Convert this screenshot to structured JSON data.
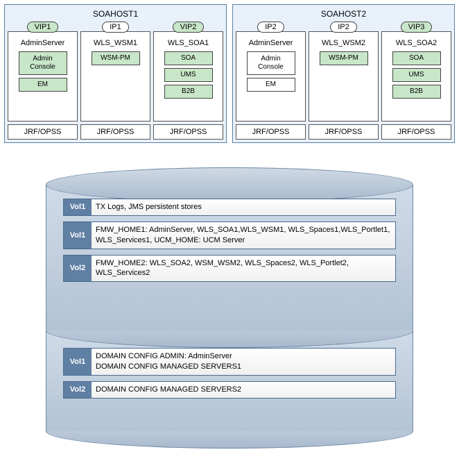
{
  "hosts": [
    {
      "title": "SOAHOST1",
      "servers": [
        {
          "pill": "VIP1",
          "pill_green": true,
          "name": "AdminServer",
          "modules": [
            {
              "text": "Admin Console",
              "green": true
            },
            {
              "text": "EM",
              "green": true
            }
          ]
        },
        {
          "pill": "IP1",
          "pill_green": false,
          "name": "WLS_WSM1",
          "modules": [
            {
              "text": "WSM-PM",
              "green": true
            }
          ]
        },
        {
          "pill": "VIP2",
          "pill_green": true,
          "name": "WLS_SOA1",
          "modules": [
            {
              "text": "SOA",
              "green": true
            },
            {
              "text": "UMS",
              "green": true
            },
            {
              "text": "B2B",
              "green": true
            }
          ]
        }
      ],
      "footers": [
        "JRF/OPSS",
        "JRF/OPSS",
        "JRF/OPSS"
      ]
    },
    {
      "title": "SOAHOST2",
      "servers": [
        {
          "pill": "IP2",
          "pill_green": false,
          "name": "AdminServer",
          "modules": [
            {
              "text": "Admin Console",
              "green": false
            },
            {
              "text": "EM",
              "green": false
            }
          ]
        },
        {
          "pill": "IP2",
          "pill_green": false,
          "name": "WLS_WSM2",
          "modules": [
            {
              "text": "WSM-PM",
              "green": true
            }
          ]
        },
        {
          "pill": "VIP3",
          "pill_green": true,
          "name": "WLS_SOA2",
          "modules": [
            {
              "text": "SOA",
              "green": true
            },
            {
              "text": "UMS",
              "green": true
            },
            {
              "text": "B2B",
              "green": true
            }
          ]
        }
      ],
      "footers": [
        "JRF/OPSS",
        "JRF/OPSS",
        "JRF/OPSS"
      ]
    }
  ],
  "disk1": {
    "volumes": [
      {
        "tag": "Vol1",
        "text": "TX Logs, JMS persistent stores"
      },
      {
        "tag": "Vol1",
        "text": "FMW_HOME1: AdminServer, WLS_SOA1,WLS_WSM1, WLS_Spaces1,WLS_Portlet1, WLS_Services1, UCM_HOME: UCM Server"
      },
      {
        "tag": "Vol2",
        "text": "FMW_HOME2: WLS_SOA2, WSM_WSM2, WLS_Spaces2, WLS_Portlet2, WLS_Services2"
      }
    ]
  },
  "disk2": {
    "volumes": [
      {
        "tag": "Vol1",
        "text": "DOMAIN CONFIG ADMIN: AdminServer\nDOMAIN CONFIG MANAGED SERVERS1"
      },
      {
        "tag": "Vol2",
        "text": "DOMAIN CONFIG MANAGED SERVERS2"
      }
    ]
  }
}
